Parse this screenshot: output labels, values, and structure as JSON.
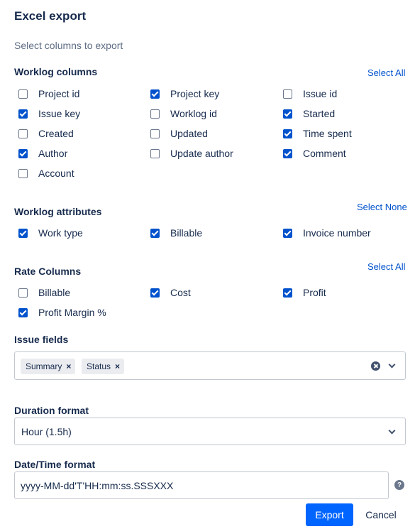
{
  "dialog": {
    "title": "Excel export",
    "subtitle": "Select columns to export"
  },
  "worklog_columns": {
    "heading": "Worklog columns",
    "action": "Select All",
    "items": [
      {
        "label": "Project id",
        "checked": false
      },
      {
        "label": "Project key",
        "checked": true
      },
      {
        "label": "Issue id",
        "checked": false
      },
      {
        "label": "Issue key",
        "checked": true
      },
      {
        "label": "Worklog id",
        "checked": false
      },
      {
        "label": "Started",
        "checked": true
      },
      {
        "label": "Created",
        "checked": false
      },
      {
        "label": "Updated",
        "checked": false
      },
      {
        "label": "Time spent",
        "checked": true
      },
      {
        "label": "Author",
        "checked": true
      },
      {
        "label": "Update author",
        "checked": false
      },
      {
        "label": "Comment",
        "checked": true
      },
      {
        "label": "Account",
        "checked": false
      }
    ]
  },
  "worklog_attributes": {
    "heading": "Worklog attributes",
    "action": "Select None",
    "items": [
      {
        "label": "Work type",
        "checked": true
      },
      {
        "label": "Billable",
        "checked": true
      },
      {
        "label": "Invoice number",
        "checked": true
      }
    ]
  },
  "rate_columns": {
    "heading": "Rate Columns",
    "action": "Select All",
    "items": [
      {
        "label": "Billable",
        "checked": false
      },
      {
        "label": "Cost",
        "checked": true
      },
      {
        "label": "Profit",
        "checked": true
      },
      {
        "label": "Profit Margin %",
        "checked": true
      }
    ]
  },
  "issue_fields": {
    "label": "Issue fields",
    "chips": [
      "Summary",
      "Status"
    ],
    "remove_glyph": "×"
  },
  "duration_format": {
    "label": "Duration format",
    "value": "Hour (1.5h)"
  },
  "datetime_format": {
    "label": "Date/Time format",
    "value": "yyyy-MM-dd'T'HH:mm:ss.SSSXXX",
    "help_glyph": "?"
  },
  "footer": {
    "export_label": "Export",
    "cancel_label": "Cancel"
  },
  "colors": {
    "primary": "#0065ff",
    "link": "#0052cc",
    "text": "#172b4d",
    "checkbox_checked": "#0052cc"
  }
}
